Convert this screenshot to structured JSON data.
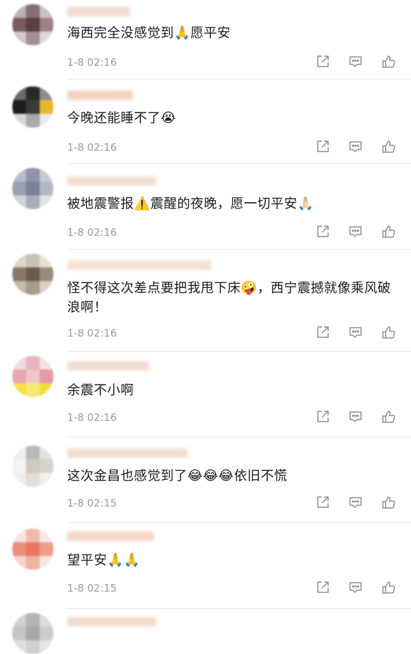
{
  "comments": [
    {
      "text": "海西完全没感觉到🙏愿平安",
      "time": "1-8 02:16"
    },
    {
      "text": "今晚还能睡不了😭",
      "time": "1-8 02:16"
    },
    {
      "text": "被地震警报⚠️震醒的夜晚，愿一切平安🙏🏻",
      "time": "1-8 02:16"
    },
    {
      "text": "怪不得这次差点要把我甩下床🤪，西宁震撼就像乘风破浪啊！",
      "time": "1-8 02:16"
    },
    {
      "text": "余震不小啊",
      "time": "1-8 02:16"
    },
    {
      "text": "这次金昌也感觉到了😂😂😂依旧不慌",
      "time": "1-8 02:15"
    },
    {
      "text": "望平安🙏🙏",
      "time": "1-8 02:15"
    }
  ],
  "icons": {
    "share": "share-icon",
    "comment": "comment-icon",
    "like": "thumbs-up-icon"
  }
}
